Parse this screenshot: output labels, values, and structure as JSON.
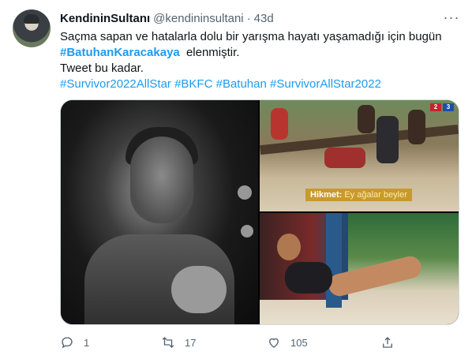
{
  "tweet": {
    "display_name": "KendininSultanı",
    "handle": "@kendininsultani",
    "separator": "·",
    "time": "43d",
    "more_label": "···",
    "text_line1": "Saçma sapan ve hatalarla dolu bir yarışma hayatı yaşamadığı için bugün",
    "mention_hashtag": "#BatuhanKaracakaya",
    "text_line2_rest": "elenmiştir.",
    "text_line3": "Tweet bu kadar.",
    "hashtags": [
      "#Survivor2022AllStar",
      "#BKFC",
      "#Batuhan",
      "#SurvivorAllStar2022"
    ],
    "media": {
      "caption_name": "Hikmet:",
      "caption_text": "Ey ağalar beyler",
      "score_left": "2",
      "score_right": "3",
      "score_colors": [
        "#c0262d",
        "#1d4ea8"
      ]
    },
    "actions": {
      "reply_count": "1",
      "retweet_count": "17",
      "like_count": "105"
    }
  },
  "colors": {
    "link": "#1d9bf0",
    "secondary_text": "#536471",
    "primary_text": "#0f1419",
    "border": "#cfd9de"
  }
}
